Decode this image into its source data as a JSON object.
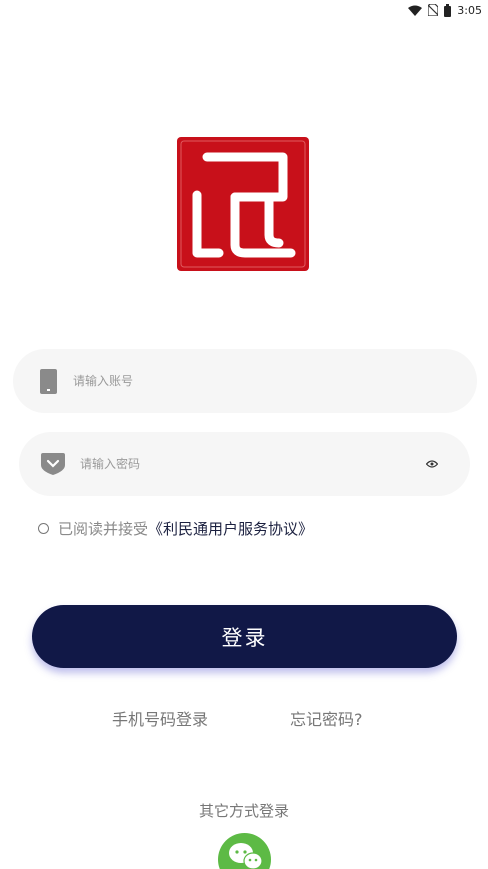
{
  "status_bar": {
    "time": "3:05"
  },
  "login_form": {
    "account_placeholder": "请输入账号",
    "password_placeholder": "请输入密码"
  },
  "agreement": {
    "text": "已阅读并接受",
    "link": "《利民通用户服务协议》"
  },
  "login_button": "登录",
  "links": {
    "phone_login": "手机号码登录",
    "forgot_password": "忘记密码?"
  },
  "other_login": {
    "title": "其它方式登录"
  },
  "colors": {
    "primary": "#111847",
    "logo_red": "#c8101a",
    "wechat_green": "#5dba45",
    "input_bg": "#f6f6f6"
  },
  "icons": [
    "wifi-icon",
    "no-sim-icon",
    "battery-icon",
    "phone-icon",
    "shield-icon",
    "eye-icon",
    "wechat-icon"
  ]
}
